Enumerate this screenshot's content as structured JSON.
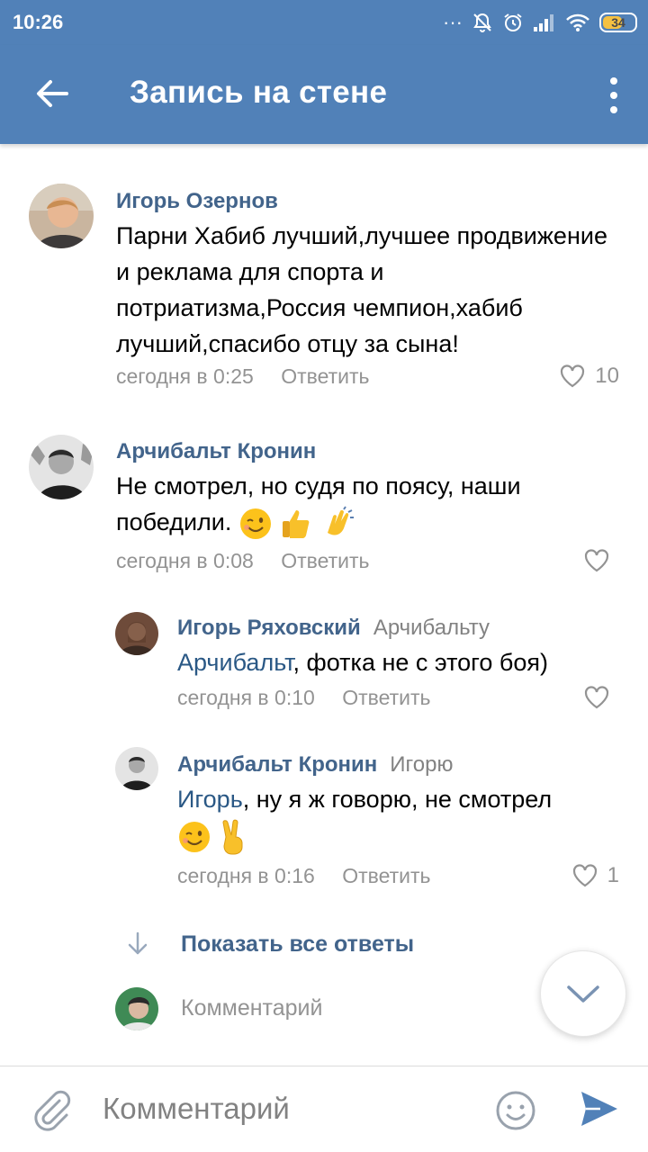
{
  "status_bar": {
    "time": "10:26",
    "battery": "34"
  },
  "app_bar": {
    "title": "Запись на стене"
  },
  "comments": [
    {
      "author": "Игорь Озернов",
      "text": "Парни Хабиб лучший,лучшее продвижение и реклама для спорта и потриатизма,Россия чемпион,хабиб лучший,спасибо отцу за сына!",
      "time": "сегодня в 0:25",
      "reply_label": "Ответить",
      "likes": "10"
    },
    {
      "author": "Арчибальт Кронин",
      "text": "Не смотрел,  но судя по поясу, наши победили.",
      "emojis": [
        "wink-emoji",
        "thumbs-up-emoji",
        "clapping-hands-emoji"
      ],
      "time": "сегодня в 0:08",
      "reply_label": "Ответить",
      "likes": ""
    },
    {
      "author": "Игорь Ряховский",
      "reply_to": "Арчибальту",
      "mention": "Арчибальт",
      "text": ", фотка не с этого боя)",
      "time": "сегодня в 0:10",
      "reply_label": "Ответить",
      "likes": ""
    },
    {
      "author": "Арчибальт Кронин",
      "reply_to": "Игорю",
      "mention": "Игорь",
      "text": ", ну я ж говорю, не смотрел",
      "emojis": [
        "wink-emoji",
        "victory-hand-emoji"
      ],
      "time": "сегодня в 0:16",
      "reply_label": "Ответить",
      "likes": "1"
    }
  ],
  "show_all_replies": "Показать все ответы",
  "inline_reply_placeholder": "Комментарий",
  "composer": {
    "placeholder": "Комментарий"
  },
  "colors": {
    "brand": "#5181b8",
    "link": "#42648b",
    "meta": "#939393"
  }
}
